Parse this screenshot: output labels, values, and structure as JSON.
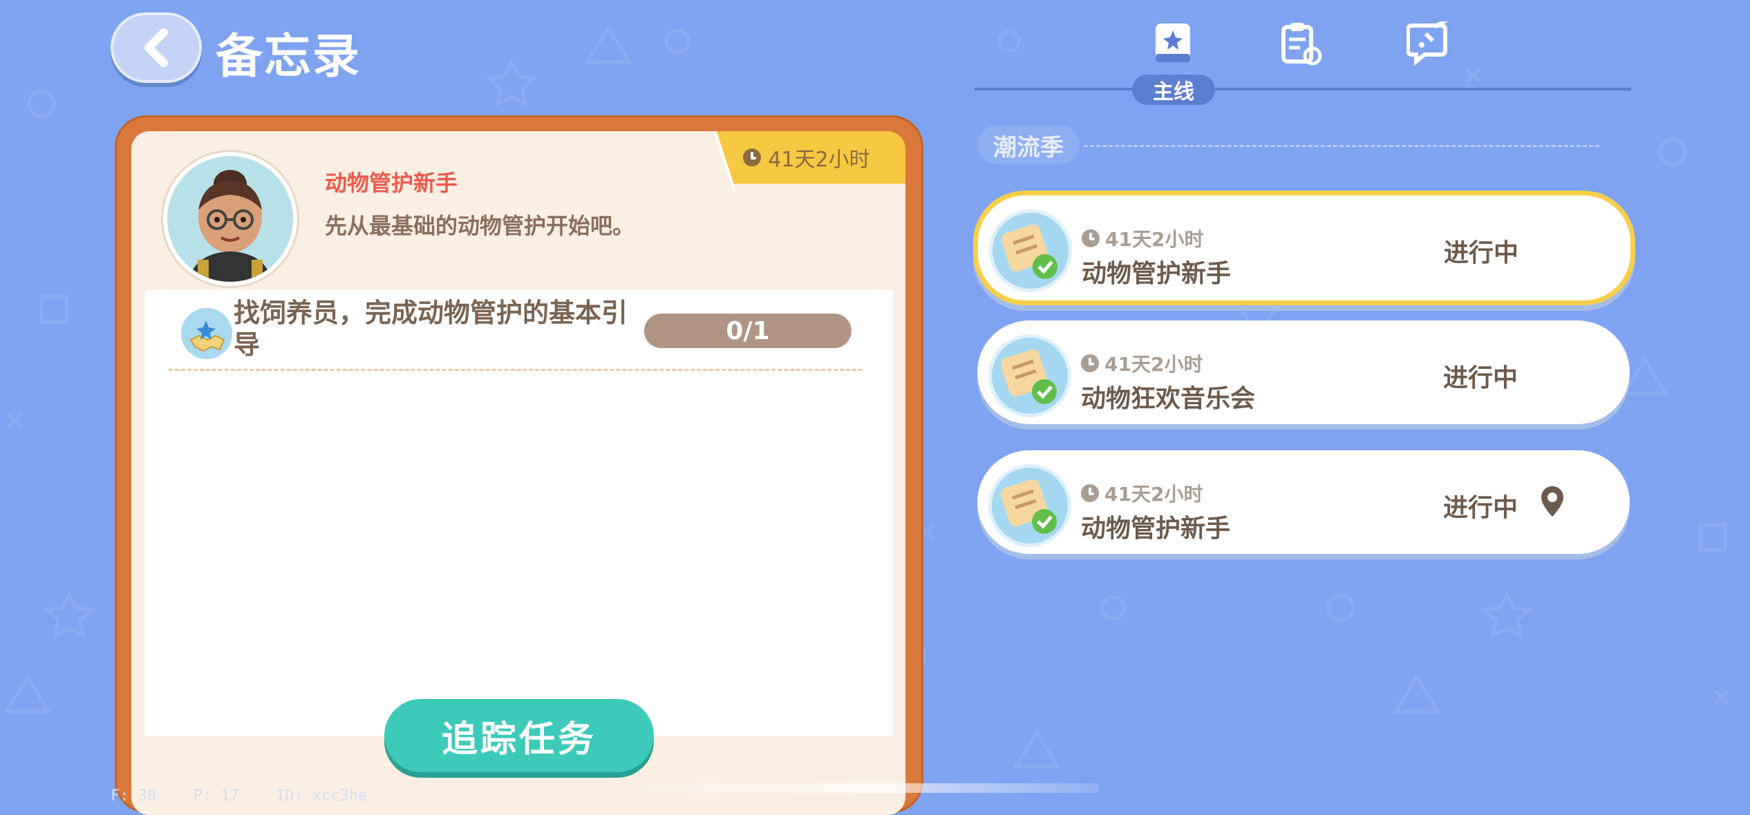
{
  "header": {
    "title": "备忘录"
  },
  "tabs": [
    {
      "label": "主线",
      "icon": "book-star-icon",
      "active": true
    },
    {
      "label": "",
      "icon": "clipboard-refresh-icon",
      "active": false
    },
    {
      "label": "",
      "icon": "edit-bubble-icon",
      "active": false
    }
  ],
  "detail": {
    "timer": "41天2小时",
    "quest_name": "动物管护新手",
    "quest_desc": "先从最基础的动物管护开始吧。",
    "task_text": "找饲养员，完成动物管护的基本引导",
    "task_progress": "0/1",
    "track_button": "追踪任务"
  },
  "season": {
    "label": "潮流季"
  },
  "quests": [
    {
      "time": "41天2小时",
      "name": "动物管护新手",
      "status": "进行中",
      "selected": true,
      "pin": false
    },
    {
      "time": "41天2小时",
      "name": "动物狂欢音乐会",
      "status": "进行中",
      "selected": false,
      "pin": false
    },
    {
      "time": "41天2小时",
      "name": "动物管护新手",
      "status": "进行中",
      "selected": false,
      "pin": true
    }
  ],
  "debug": {
    "fps": "F: 30",
    "ping": "P: 17",
    "id": "ID: xcc3he"
  }
}
